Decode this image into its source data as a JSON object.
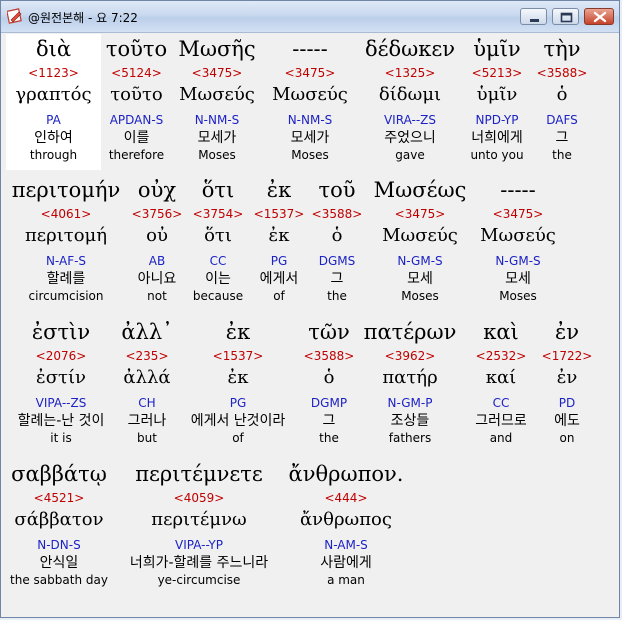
{
  "window": {
    "title": "@원전본해 - 요 7:22",
    "icon": "app-edit-icon",
    "buttons": [
      "minimize-icon",
      "maximize-icon",
      "close-icon"
    ]
  },
  "colors": {
    "strong": "#c00000",
    "parse": "#1c22c4",
    "text": "#000000",
    "highlight": "#ffffff"
  },
  "words": [
    {
      "greek": "διὰ",
      "strong": "<1123>",
      "lemma": "γραπτός",
      "parse": "PA",
      "korean": "인하여",
      "english": "through"
    },
    {
      "greek": "τοῦτο",
      "strong": "<5124>",
      "lemma": "τοῦτο",
      "parse": "APDAN-S",
      "korean": "이를",
      "english": "therefore"
    },
    {
      "greek": "Μωσῆς",
      "strong": "<3475>",
      "lemma": "Μωσεύς",
      "parse": "N-NM-S",
      "korean": "모세가",
      "english": "Moses"
    },
    {
      "greek": "-----",
      "strong": "<3475>",
      "lemma": "Μωσεύς",
      "parse": "N-NM-S",
      "korean": "모세가",
      "english": "Moses"
    },
    {
      "greek": "δέδωκεν",
      "strong": "<1325>",
      "lemma": "δίδωμι",
      "parse": "VIRA--ZS",
      "korean": "주었으니",
      "english": "gave"
    },
    {
      "greek": "ὑμῖν",
      "strong": "<5213>",
      "lemma": "ὑμῖν",
      "parse": "NPD-YP",
      "korean": "너희에게",
      "english": "unto you"
    },
    {
      "greek": "τὴν",
      "strong": "<3588>",
      "lemma": "ὁ",
      "parse": "DAFS",
      "korean": "그",
      "english": "the"
    },
    {
      "greek": "περιτομήν",
      "strong": "<4061>",
      "lemma": "περιτομή",
      "parse": "N-AF-S",
      "korean": "할례를",
      "english": "circumcision"
    },
    {
      "greek": "οὐχ",
      "strong": "<3756>",
      "lemma": "οὐ",
      "parse": "AB",
      "korean": "아니요",
      "english": "not"
    },
    {
      "greek": "ὅτι",
      "strong": "<3754>",
      "lemma": "ὅτι",
      "parse": "CC",
      "korean": "이는",
      "english": "because"
    },
    {
      "greek": "ἐκ",
      "strong": "<1537>",
      "lemma": "ἐκ",
      "parse": "PG",
      "korean": "에게서",
      "english": "of"
    },
    {
      "greek": "τοῦ",
      "strong": "<3588>",
      "lemma": "ὁ",
      "parse": "DGMS",
      "korean": "그",
      "english": "the"
    },
    {
      "greek": "Μωσέως",
      "strong": "<3475>",
      "lemma": "Μωσεύς",
      "parse": "N-GM-S",
      "korean": "모세",
      "english": "Moses"
    },
    {
      "greek": "-----",
      "strong": "<3475>",
      "lemma": "Μωσεύς",
      "parse": "N-GM-S",
      "korean": "모세",
      "english": "Moses"
    },
    {
      "greek": "ἐστὶν",
      "strong": "<2076>",
      "lemma": "ἐστίν",
      "parse": "VIPA--ZS",
      "korean": "할례는-난 것이",
      "english": "it is"
    },
    {
      "greek": "ἀλλ᾽",
      "strong": "<235>",
      "lemma": "ἀλλά",
      "parse": "CH",
      "korean": "그러나",
      "english": "but"
    },
    {
      "greek": "ἐκ",
      "strong": "<1537>",
      "lemma": "ἐκ",
      "parse": "PG",
      "korean": "에게서 난것이라",
      "english": "of"
    },
    {
      "greek": "τῶν",
      "strong": "<3588>",
      "lemma": "ὁ",
      "parse": "DGMP",
      "korean": "그",
      "english": "the"
    },
    {
      "greek": "πατέρων",
      "strong": "<3962>",
      "lemma": "πατήρ",
      "parse": "N-GM-P",
      "korean": "조상들",
      "english": "fathers"
    },
    {
      "greek": "καὶ",
      "strong": "<2532>",
      "lemma": "καί",
      "parse": "CC",
      "korean": "그러므로",
      "english": "and"
    },
    {
      "greek": "ἐν",
      "strong": "<1722>",
      "lemma": "ἐν",
      "parse": "PD",
      "korean": "에도",
      "english": "on"
    },
    {
      "greek": "σαββάτῳ",
      "strong": "<4521>",
      "lemma": "σάββατον",
      "parse": "N-DN-S",
      "korean": "안식일",
      "english": "the sabbath day"
    },
    {
      "greek": "περιτέμνετε",
      "strong": "<4059>",
      "lemma": "περιτέμνω",
      "parse": "VIPA--YP",
      "korean": "너희가-할례를 주느니라",
      "english": "ye-circumcise"
    },
    {
      "greek": "ἄνθρωπον.",
      "strong": "<444>",
      "lemma": "ἄνθρωπος",
      "parse": "N-AM-S",
      "korean": "사람에게",
      "english": "a man"
    }
  ]
}
